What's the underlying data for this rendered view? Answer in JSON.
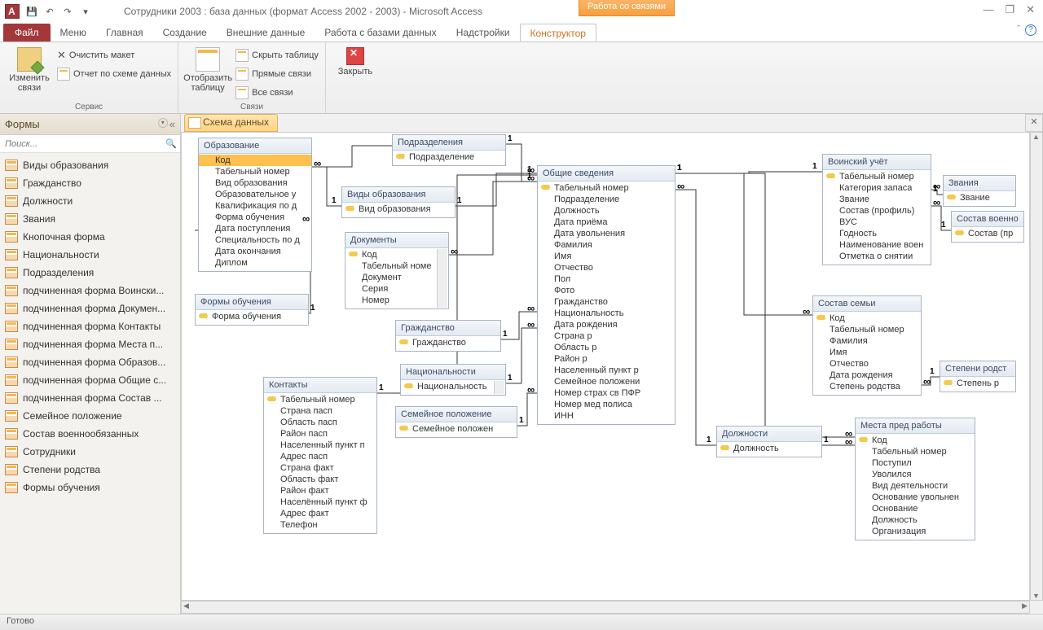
{
  "window": {
    "title": "Сотрудники 2003 : база данных (формат Access 2002 - 2003)  -  Microsoft Access",
    "context_title": "Работа со связями"
  },
  "tabs": {
    "file": "Файл",
    "items": [
      "Меню",
      "Главная",
      "Создание",
      "Внешние данные",
      "Работа с базами данных",
      "Надстройки",
      "Конструктор"
    ]
  },
  "ribbon": {
    "group1_label": "Сервис",
    "edit_rel": "Изменить связи",
    "clear_layout": "Очистить макет",
    "schema_report": "Отчет по схеме данных",
    "group2_label": " ",
    "show_table": "Отобразить таблицу",
    "group3_label": "Связи",
    "hide_table": "Скрыть таблицу",
    "direct_rel": "Прямые связи",
    "all_rel": "Все связи",
    "close": "Закрыть"
  },
  "nav": {
    "header": "Формы",
    "search_placeholder": "Поиск...",
    "items": [
      "Виды образования",
      "Гражданство",
      "Должности",
      "Звания",
      "Кнопочная форма",
      "Национальности",
      "Подразделения",
      "подчиненная форма Воински...",
      "подчиненная форма Докумен...",
      "подчиненная форма Контакты",
      "подчиненная форма Места п...",
      "подчиненная форма Образов...",
      "подчиненная форма Общие с...",
      "подчиненная форма Состав ...",
      "Семейное положение",
      "Состав военнообязанных",
      "Сотрудники",
      "Степени родства",
      "Формы обучения"
    ]
  },
  "doc_tab": "Схема данных",
  "tables": {
    "education": {
      "title": "Образование",
      "rows": [
        {
          "t": "Код",
          "k": true,
          "sel": true
        },
        {
          "t": "Табельный номер"
        },
        {
          "t": "Вид образования"
        },
        {
          "t": "Образовательное у"
        },
        {
          "t": "Квалификация по д"
        },
        {
          "t": "Форма обучения"
        },
        {
          "t": "Дата поступления"
        },
        {
          "t": "Специальность по д"
        },
        {
          "t": "Дата окончания"
        },
        {
          "t": "Диплом"
        }
      ]
    },
    "edu_forms": {
      "title": "Формы обучения",
      "rows": [
        {
          "t": "Форма обучения",
          "k": true
        }
      ]
    },
    "edu_types": {
      "title": "Виды образования",
      "rows": [
        {
          "t": "Вид образования",
          "k": true
        }
      ]
    },
    "documents": {
      "title": "Документы",
      "rows": [
        {
          "t": "Код",
          "k": true
        },
        {
          "t": "Табельный номе"
        },
        {
          "t": "Документ"
        },
        {
          "t": "Серия"
        },
        {
          "t": "Номер"
        }
      ]
    },
    "citizenship": {
      "title": "Гражданство",
      "rows": [
        {
          "t": "Гражданство",
          "k": true
        }
      ]
    },
    "nationality": {
      "title": "Национальности",
      "rows": [
        {
          "t": "Национальность",
          "k": true
        }
      ]
    },
    "marital": {
      "title": "Семейное положение",
      "rows": [
        {
          "t": "Семейное положен",
          "k": true
        }
      ]
    },
    "subdiv": {
      "title": "Подразделения",
      "rows": [
        {
          "t": "Подразделение",
          "k": true
        }
      ]
    },
    "general": {
      "title": "Общие сведения",
      "rows": [
        {
          "t": "Табельный номер",
          "k": true
        },
        {
          "t": "Подразделение"
        },
        {
          "t": "Должность"
        },
        {
          "t": "Дата приёма"
        },
        {
          "t": "Дата увольнения"
        },
        {
          "t": "Фамилия"
        },
        {
          "t": "Имя"
        },
        {
          "t": "Отчество"
        },
        {
          "t": "Пол"
        },
        {
          "t": "Фото"
        },
        {
          "t": "Гражданство"
        },
        {
          "t": "Национальность"
        },
        {
          "t": "Дата рождения"
        },
        {
          "t": "Страна р"
        },
        {
          "t": "Область р"
        },
        {
          "t": "Район р"
        },
        {
          "t": "Населенный пункт р"
        },
        {
          "t": "Семейное положени"
        },
        {
          "t": "Номер страх св ПФР"
        },
        {
          "t": "Номер мед полиса"
        },
        {
          "t": "ИНН"
        }
      ]
    },
    "positions": {
      "title": "Должности",
      "rows": [
        {
          "t": "Должность",
          "k": true
        }
      ]
    },
    "contacts": {
      "title": "Контакты",
      "rows": [
        {
          "t": "Табельный номер",
          "k": true
        },
        {
          "t": "Страна пасп"
        },
        {
          "t": "Область пасп"
        },
        {
          "t": "Район пасп"
        },
        {
          "t": "Населенный пункт п"
        },
        {
          "t": "Адрес пасп"
        },
        {
          "t": "Страна факт"
        },
        {
          "t": "Область факт"
        },
        {
          "t": "Район факт"
        },
        {
          "t": "Населённый пункт ф"
        },
        {
          "t": "Адрес факт"
        },
        {
          "t": "Телефон"
        }
      ]
    },
    "military": {
      "title": "Воинский учёт",
      "rows": [
        {
          "t": "Табельный номер",
          "k": true
        },
        {
          "t": "Категория запаса"
        },
        {
          "t": "Звание"
        },
        {
          "t": "Состав (профиль)"
        },
        {
          "t": "ВУС"
        },
        {
          "t": "Годность"
        },
        {
          "t": "Наименование воен"
        },
        {
          "t": "Отметка о снятии"
        }
      ]
    },
    "family": {
      "title": "Состав семьи",
      "rows": [
        {
          "t": "Код",
          "k": true
        },
        {
          "t": "Табельный номер"
        },
        {
          "t": "Фамилия"
        },
        {
          "t": "Имя"
        },
        {
          "t": "Отчество"
        },
        {
          "t": "Дата рождения"
        },
        {
          "t": "Степень родства"
        }
      ]
    },
    "ranks": {
      "title": "Звания",
      "rows": [
        {
          "t": "Звание",
          "k": true
        }
      ]
    },
    "reserve": {
      "title": "Состав военно",
      "rows": [
        {
          "t": "Состав (пр",
          "k": true
        }
      ]
    },
    "kinship": {
      "title": "Степени родст",
      "rows": [
        {
          "t": "Степень р",
          "k": true
        }
      ]
    },
    "prevjobs": {
      "title": "Места пред работы",
      "rows": [
        {
          "t": "Код",
          "k": true
        },
        {
          "t": "Табельный номер"
        },
        {
          "t": "Поступил"
        },
        {
          "t": "Уволился"
        },
        {
          "t": "Вид деятельности"
        },
        {
          "t": "Основание увольнен"
        },
        {
          "t": "Основание"
        },
        {
          "t": "Должность"
        },
        {
          "t": "Организация"
        }
      ]
    }
  },
  "status": "Готово"
}
